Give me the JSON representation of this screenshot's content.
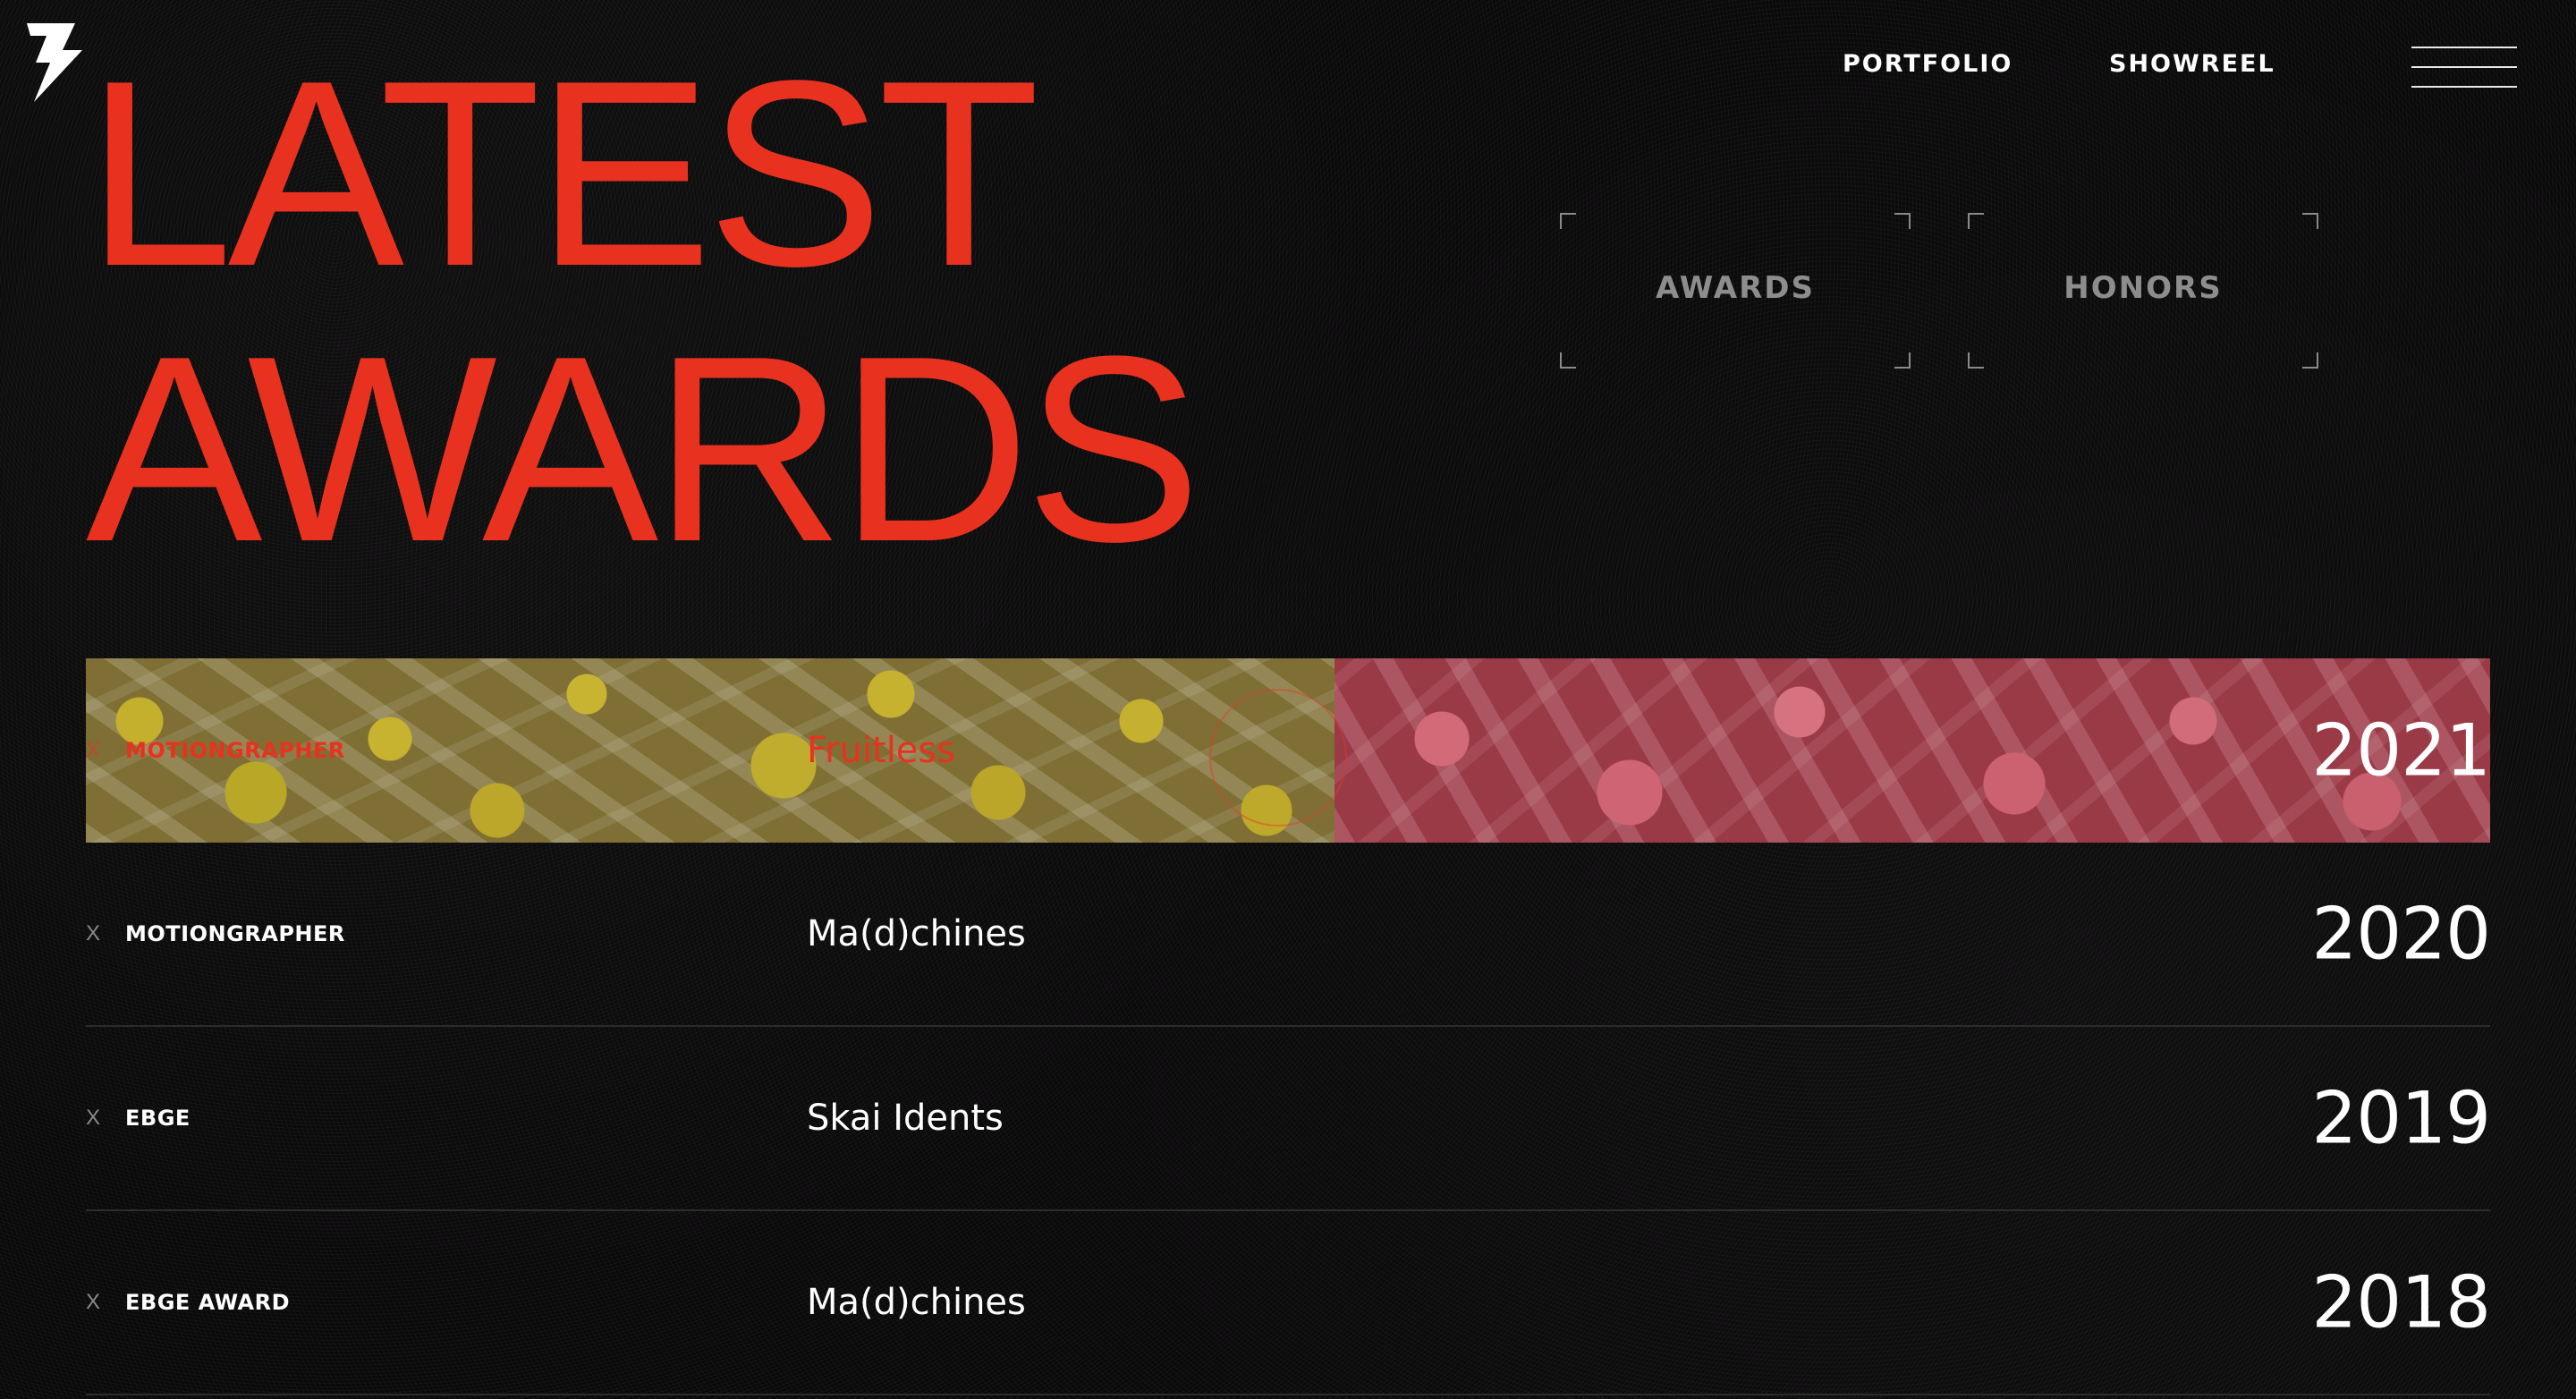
{
  "hero": {
    "title_line1": "LATEST",
    "title_line2": "AWARDS"
  },
  "nav": {
    "portfolio": "PORTFOLIO",
    "showreel": "SHOWREEL"
  },
  "filters": {
    "awards": "AWARDS",
    "honors": "HONORS"
  },
  "awards": [
    {
      "marker": "X",
      "source": "MOTIONGRAPHER",
      "project": "Fruitless",
      "year": "2021",
      "active": true
    },
    {
      "marker": "X",
      "source": "MOTIONGRAPHER",
      "project": "Ma(d)chines",
      "year": "2020",
      "active": false
    },
    {
      "marker": "X",
      "source": "EBGE",
      "project": "Skai Idents",
      "year": "2019",
      "active": false
    },
    {
      "marker": "X",
      "source": "EBGE AWARD",
      "project": "Ma(d)chines",
      "year": "2018",
      "active": false
    }
  ],
  "colors": {
    "accent": "#e8321f",
    "background": "#0b0a0b",
    "text": "#ffffff",
    "muted": "#8d8d8d"
  },
  "icons": {
    "logo": "lightning-bolt-logo",
    "menu": "hamburger-menu-icon"
  }
}
